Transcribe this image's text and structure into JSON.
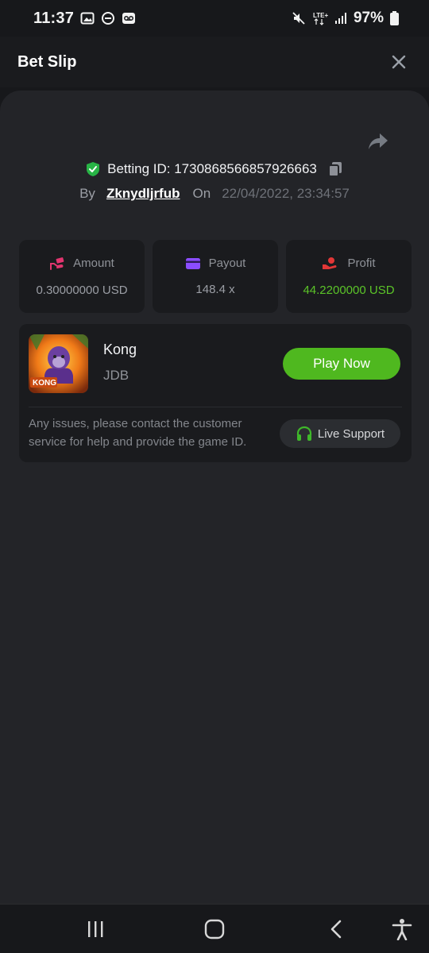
{
  "status_bar": {
    "time": "11:37",
    "battery": "97%",
    "icons": [
      "gallery-icon",
      "dnd-icon",
      "voicemail-icon",
      "mute-icon",
      "lte-icon",
      "signal-icon",
      "battery-icon"
    ]
  },
  "header": {
    "title": "Bet Slip",
    "close_icon": "close-icon"
  },
  "bet": {
    "betting_id_label": "Betting ID: 1730868566857926663",
    "by_label": "By",
    "username": "Zknydljrfub",
    "on_label": "On",
    "date": "22/04/2022, 23:34:57"
  },
  "stats": [
    {
      "label": "Amount",
      "value": "0.30000000 USD",
      "icon": "amount-icon",
      "icon_color": "#e2356f"
    },
    {
      "label": "Payout",
      "value": "148.4 x",
      "icon": "card-icon",
      "icon_color": "#8b4dff"
    },
    {
      "label": "Profit",
      "value": "44.2200000 USD",
      "icon": "profit-hand-icon",
      "icon_color": "#e23737"
    }
  ],
  "game": {
    "name": "Kong",
    "provider": "JDB",
    "play_label": "Play Now",
    "thumb_text": "KONG"
  },
  "support": {
    "help_text": "Any issues, please contact the customer service for help and provide the game ID.",
    "button_label": "Live Support"
  },
  "colors": {
    "accent_green": "#4fb81f",
    "profit_green": "#5bc428",
    "background": "#17181b",
    "card": "#1a1b1e",
    "sheet": "#232428"
  }
}
